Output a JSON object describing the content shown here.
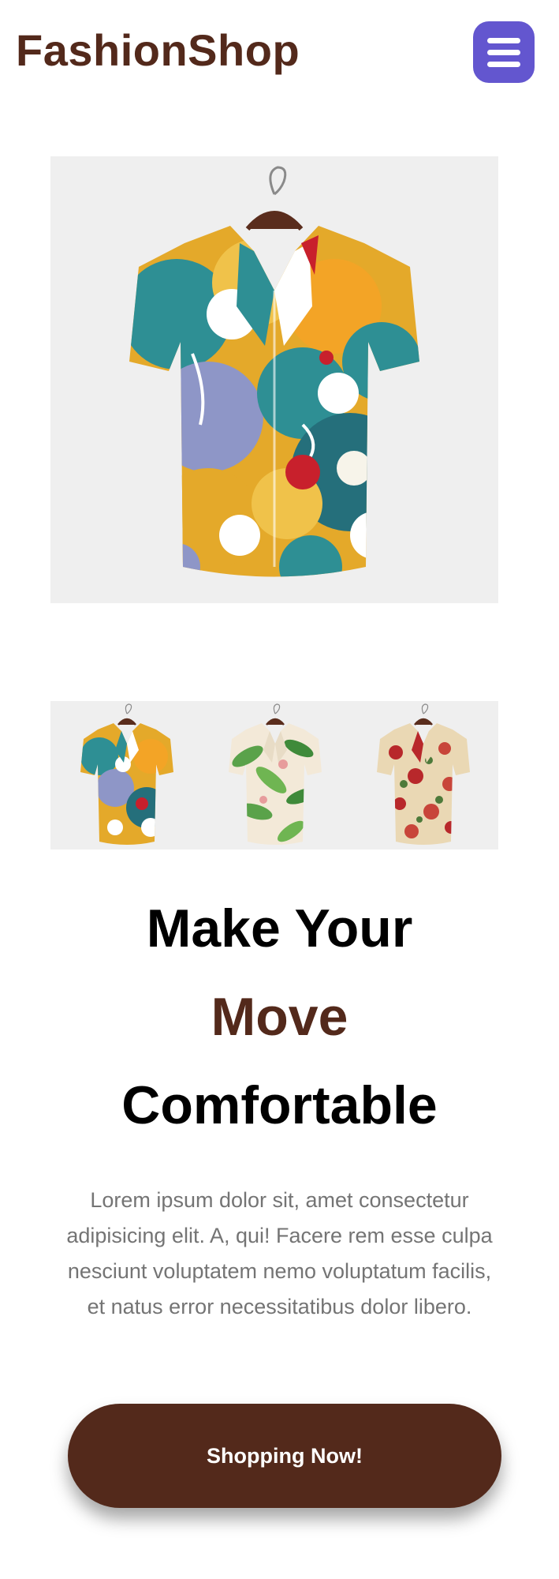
{
  "header": {
    "brand": "FashionShop",
    "menu_icon": "hamburger-menu-icon",
    "menu_color": "#6356cf"
  },
  "hero": {
    "image": "shirt-multicolor-abstract-print",
    "background": "#efefef"
  },
  "thumbnails": [
    {
      "image": "shirt-multicolor-abstract-print"
    },
    {
      "image": "shirt-green-leaf-print"
    },
    {
      "image": "shirt-red-floral-print"
    }
  ],
  "headline": {
    "line1": "Make Your",
    "line2": "Move",
    "line3": "Comfortable"
  },
  "description": "Lorem ipsum dolor sit, amet consectetur adipisicing elit. A, qui! Facere rem esse culpa nesciunt voluptatem nemo voluptatum facilis, et natus error necessitatibus dolor libero.",
  "cta": {
    "label": "Shopping Now!"
  },
  "colors": {
    "brand_brown": "#53291b",
    "menu_purple": "#6356cf",
    "text_gray": "#747474",
    "image_bg": "#efefef"
  }
}
